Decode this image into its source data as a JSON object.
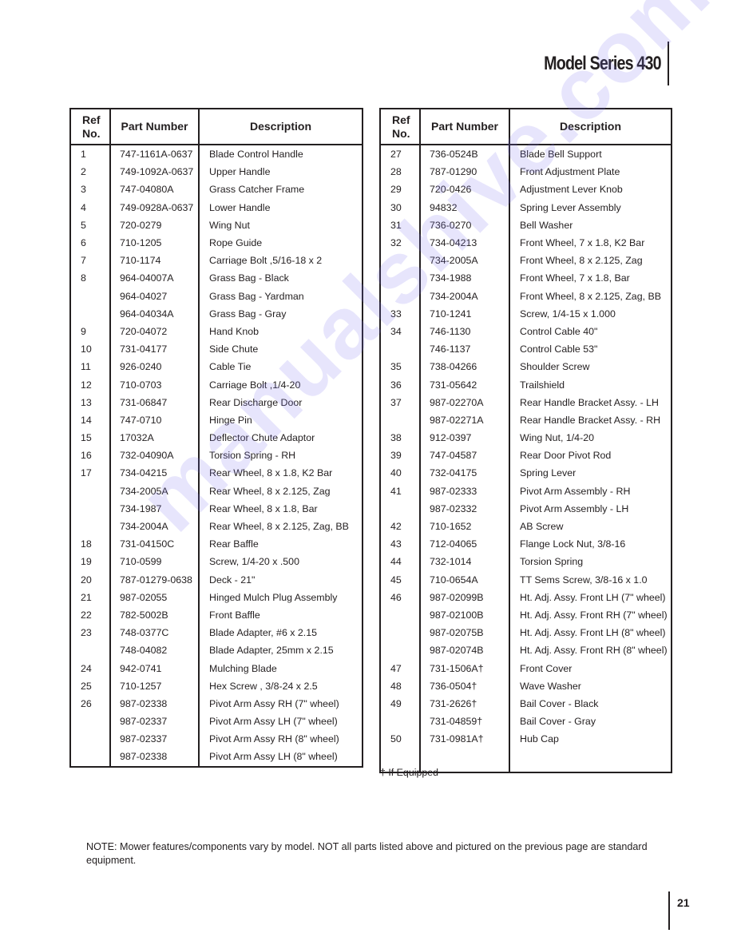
{
  "header": {
    "title": "Model Series 430"
  },
  "columns": {
    "ref": "Ref No.",
    "part": "Part Number",
    "desc": "Description"
  },
  "left_table": [
    {
      "ref": "1",
      "part": "747-1161A-0637",
      "desc": "Blade Control Handle"
    },
    {
      "ref": "2",
      "part": "749-1092A-0637",
      "desc": "Upper Handle"
    },
    {
      "ref": "3",
      "part": "747-04080A",
      "desc": "Grass Catcher Frame"
    },
    {
      "ref": "4",
      "part": "749-0928A-0637",
      "desc": "Lower Handle"
    },
    {
      "ref": "5",
      "part": "720-0279",
      "desc": "Wing Nut"
    },
    {
      "ref": "6",
      "part": "710-1205",
      "desc": "Rope Guide"
    },
    {
      "ref": "7",
      "part": "710-1174",
      "desc": "Carriage Bolt ,5/16-18 x 2"
    },
    {
      "ref": "8",
      "part": "964-04007A",
      "desc": "Grass Bag - Black"
    },
    {
      "ref": "",
      "part": "964-04027",
      "desc": "Grass Bag - Yardman"
    },
    {
      "ref": "",
      "part": "964-04034A",
      "desc": "Grass Bag - Gray"
    },
    {
      "ref": "9",
      "part": "720-04072",
      "desc": "Hand Knob"
    },
    {
      "ref": "10",
      "part": "731-04177",
      "desc": "Side Chute"
    },
    {
      "ref": "11",
      "part": "926-0240",
      "desc": "Cable Tie"
    },
    {
      "ref": "12",
      "part": "710-0703",
      "desc": "Carriage Bolt ,1/4-20"
    },
    {
      "ref": "13",
      "part": "731-06847",
      "desc": "Rear Discharge Door"
    },
    {
      "ref": "14",
      "part": "747-0710",
      "desc": "Hinge Pin"
    },
    {
      "ref": "15",
      "part": "17032A",
      "desc": "Deflector Chute Adaptor"
    },
    {
      "ref": "16",
      "part": "732-04090A",
      "desc": "Torsion Spring - RH"
    },
    {
      "ref": "17",
      "part": "734-04215",
      "desc": "Rear Wheel, 8 x 1.8, K2 Bar"
    },
    {
      "ref": "",
      "part": "734-2005A",
      "desc": "Rear Wheel, 8 x 2.125, Zag"
    },
    {
      "ref": "",
      "part": "734-1987",
      "desc": "Rear Wheel, 8 x 1.8, Bar"
    },
    {
      "ref": "",
      "part": "734-2004A",
      "desc": "Rear Wheel, 8 x 2.125, Zag, BB"
    },
    {
      "ref": "18",
      "part": "731-04150C",
      "desc": "Rear Baffle"
    },
    {
      "ref": "19",
      "part": "710-0599",
      "desc": "Screw, 1/4-20 x .500"
    },
    {
      "ref": "20",
      "part": "787-01279-0638",
      "desc": "Deck - 21\""
    },
    {
      "ref": "21",
      "part": "987-02055",
      "desc": "Hinged Mulch Plug Assembly"
    },
    {
      "ref": "22",
      "part": "782-5002B",
      "desc": "Front Baffle"
    },
    {
      "ref": "23",
      "part": "748-0377C",
      "desc": "Blade Adapter, #6 x 2.15"
    },
    {
      "ref": "",
      "part": "748-04082",
      "desc": "Blade Adapter, 25mm x 2.15"
    },
    {
      "ref": "24",
      "part": "942-0741",
      "desc": "Mulching Blade"
    },
    {
      "ref": "25",
      "part": "710-1257",
      "desc": "Hex Screw , 3/8-24 x 2.5"
    },
    {
      "ref": "26",
      "part": "987-02338",
      "desc": "Pivot Arm Assy RH (7\" wheel)"
    },
    {
      "ref": "",
      "part": "987-02337",
      "desc": "Pivot Arm Assy LH (7\" wheel)"
    },
    {
      "ref": "",
      "part": "987-02337",
      "desc": "Pivot Arm Assy RH (8\" wheel)"
    },
    {
      "ref": "",
      "part": "987-02338",
      "desc": "Pivot Arm Assy LH (8\" wheel)"
    }
  ],
  "right_table": [
    {
      "ref": "27",
      "part": "736-0524B",
      "desc": "Blade Bell Support"
    },
    {
      "ref": "28",
      "part": "787-01290",
      "desc": "Front Adjustment Plate"
    },
    {
      "ref": "29",
      "part": "720-0426",
      "desc": "Adjustment Lever Knob"
    },
    {
      "ref": "30",
      "part": "94832",
      "desc": "Spring Lever Assembly"
    },
    {
      "ref": "31",
      "part": "736-0270",
      "desc": "Bell Washer"
    },
    {
      "ref": "32",
      "part": "734-04213",
      "desc": "Front Wheel, 7 x 1.8, K2 Bar"
    },
    {
      "ref": "",
      "part": "734-2005A",
      "desc": "Front Wheel, 8 x 2.125, Zag"
    },
    {
      "ref": "",
      "part": "734-1988",
      "desc": "Front Wheel, 7 x 1.8, Bar"
    },
    {
      "ref": "",
      "part": "734-2004A",
      "desc": "Front Wheel, 8 x 2.125, Zag, BB"
    },
    {
      "ref": "33",
      "part": "710-1241",
      "desc": "Screw, 1/4-15 x 1.000"
    },
    {
      "ref": "34",
      "part": "746-1130",
      "desc": "Control Cable 40\""
    },
    {
      "ref": "",
      "part": "746-1137",
      "desc": "Control Cable 53\""
    },
    {
      "ref": "35",
      "part": "738-04266",
      "desc": "Shoulder Screw"
    },
    {
      "ref": "36",
      "part": "731-05642",
      "desc": "Trailshield"
    },
    {
      "ref": "37",
      "part": "987-02270A",
      "desc": "Rear Handle Bracket Assy. - LH"
    },
    {
      "ref": "",
      "part": "987-02271A",
      "desc": "Rear Handle Bracket Assy. - RH"
    },
    {
      "ref": "38",
      "part": "912-0397",
      "desc": "Wing Nut, 1/4-20"
    },
    {
      "ref": "39",
      "part": "747-04587",
      "desc": "Rear Door Pivot Rod"
    },
    {
      "ref": "40",
      "part": "732-04175",
      "desc": "Spring Lever"
    },
    {
      "ref": "41",
      "part": "987-02333",
      "desc": "Pivot Arm Assembly - RH"
    },
    {
      "ref": "",
      "part": "987-02332",
      "desc": "Pivot Arm Assembly - LH"
    },
    {
      "ref": "42",
      "part": "710-1652",
      "desc": "AB Screw"
    },
    {
      "ref": "43",
      "part": "712-04065",
      "desc": "Flange Lock Nut, 3/8-16"
    },
    {
      "ref": "44",
      "part": "732-1014",
      "desc": "Torsion Spring"
    },
    {
      "ref": "45",
      "part": "710-0654A",
      "desc": "TT Sems Screw, 3/8-16 x 1.0"
    },
    {
      "ref": "46",
      "part": "987-02099B",
      "desc": "Ht. Adj. Assy. Front LH (7\" wheel)"
    },
    {
      "ref": "",
      "part": "987-02100B",
      "desc": "Ht. Adj. Assy. Front RH (7\" wheel)"
    },
    {
      "ref": "",
      "part": "987-02075B",
      "desc": "Ht. Adj. Assy. Front LH (8\" wheel)"
    },
    {
      "ref": "",
      "part": "987-02074B",
      "desc": "Ht. Adj. Assy. Front RH (8\" wheel)"
    },
    {
      "ref": "47",
      "part": "731-1506A†",
      "desc": "Front Cover"
    },
    {
      "ref": "48",
      "part": "736-0504†",
      "desc": "Wave Washer"
    },
    {
      "ref": "49",
      "part": "731-2626†",
      "desc": "Bail Cover - Black"
    },
    {
      "ref": "",
      "part": "731-04859†",
      "desc": "Bail Cover - Gray"
    },
    {
      "ref": "50",
      "part": "731-0981A†",
      "desc": "Hub Cap"
    }
  ],
  "footnote": "† If Equipped",
  "note": "NOTE: Mower features/components vary by model. NOT all parts listed above and pictured on the previous page are standard equipment.",
  "page_number": "21",
  "watermark": "manualshive.com"
}
